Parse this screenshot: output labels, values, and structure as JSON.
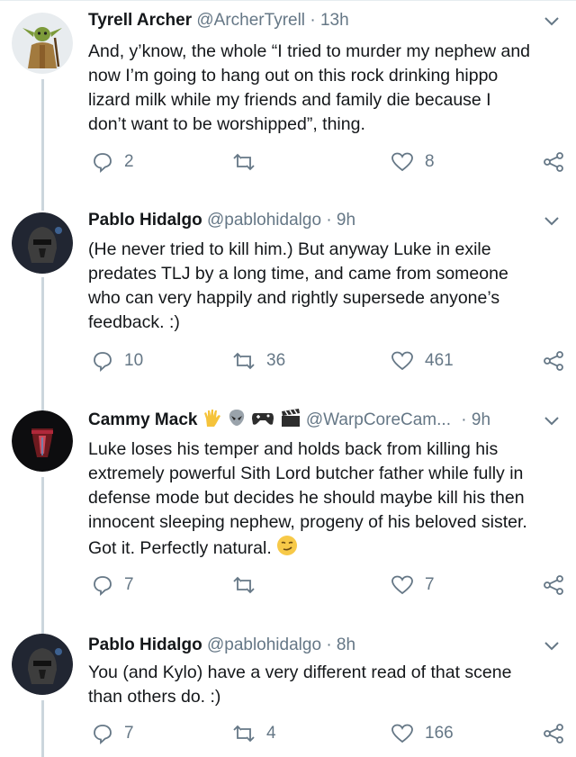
{
  "tweets": [
    {
      "name": "Tyrell Archer",
      "handle": "@ArcherTyrell",
      "time": "13h",
      "lines": [
        "And, y’know, the whole “I tried to murder my nephew and",
        "now I’m going to hang out on this rock drinking hippo",
        "lizard milk while my friends and family die because I",
        "don’t want to be worshipped”, thing."
      ],
      "replies": "2",
      "retweets": "",
      "likes": "8",
      "avatar": "yoda-avatar"
    },
    {
      "name": "Pablo Hidalgo",
      "handle": "@pablohidalgo",
      "time": "9h",
      "lines": [
        "(He never tried to kill him.) But anyway Luke in exile",
        "predates TLJ by a long time, and came from someone",
        "who can very happily and rightly supersede anyone’s",
        "feedback. :)"
      ],
      "replies": "10",
      "retweets": "36",
      "likes": "461",
      "avatar": "dark-helmet-avatar"
    },
    {
      "name": "Cammy Mack",
      "handle": "@WarpCoreCam...",
      "time": "9h",
      "name_emojis": [
        "vulcan-salute-emoji",
        "alien-emoji",
        "game-controller-emoji",
        "clapper-board-emoji"
      ],
      "lines": [
        "Luke loses his temper and holds back from killing his",
        "extremely powerful Sith Lord butcher father while fully in",
        "defense mode but decides he should maybe kill his then",
        "innocent sleeping nephew, progeny of his beloved sister.",
        "Got it. Perfectly natural."
      ],
      "end_emoji": "smirking-face-emoji",
      "replies": "7",
      "retweets": "",
      "likes": "7",
      "avatar": "red-helmet-avatar"
    },
    {
      "name": "Pablo Hidalgo",
      "handle": "@pablohidalgo",
      "time": "8h",
      "lines": [
        "You (and Kylo) have a very different read of that scene",
        "than others do. :)"
      ],
      "replies": "7",
      "retweets": "4",
      "likes": "166",
      "avatar": "dark-helmet-avatar"
    }
  ],
  "separator": "·",
  "colors": {
    "text": "#14171a",
    "secondary": "#657786",
    "thread": "#ccd6dd"
  }
}
